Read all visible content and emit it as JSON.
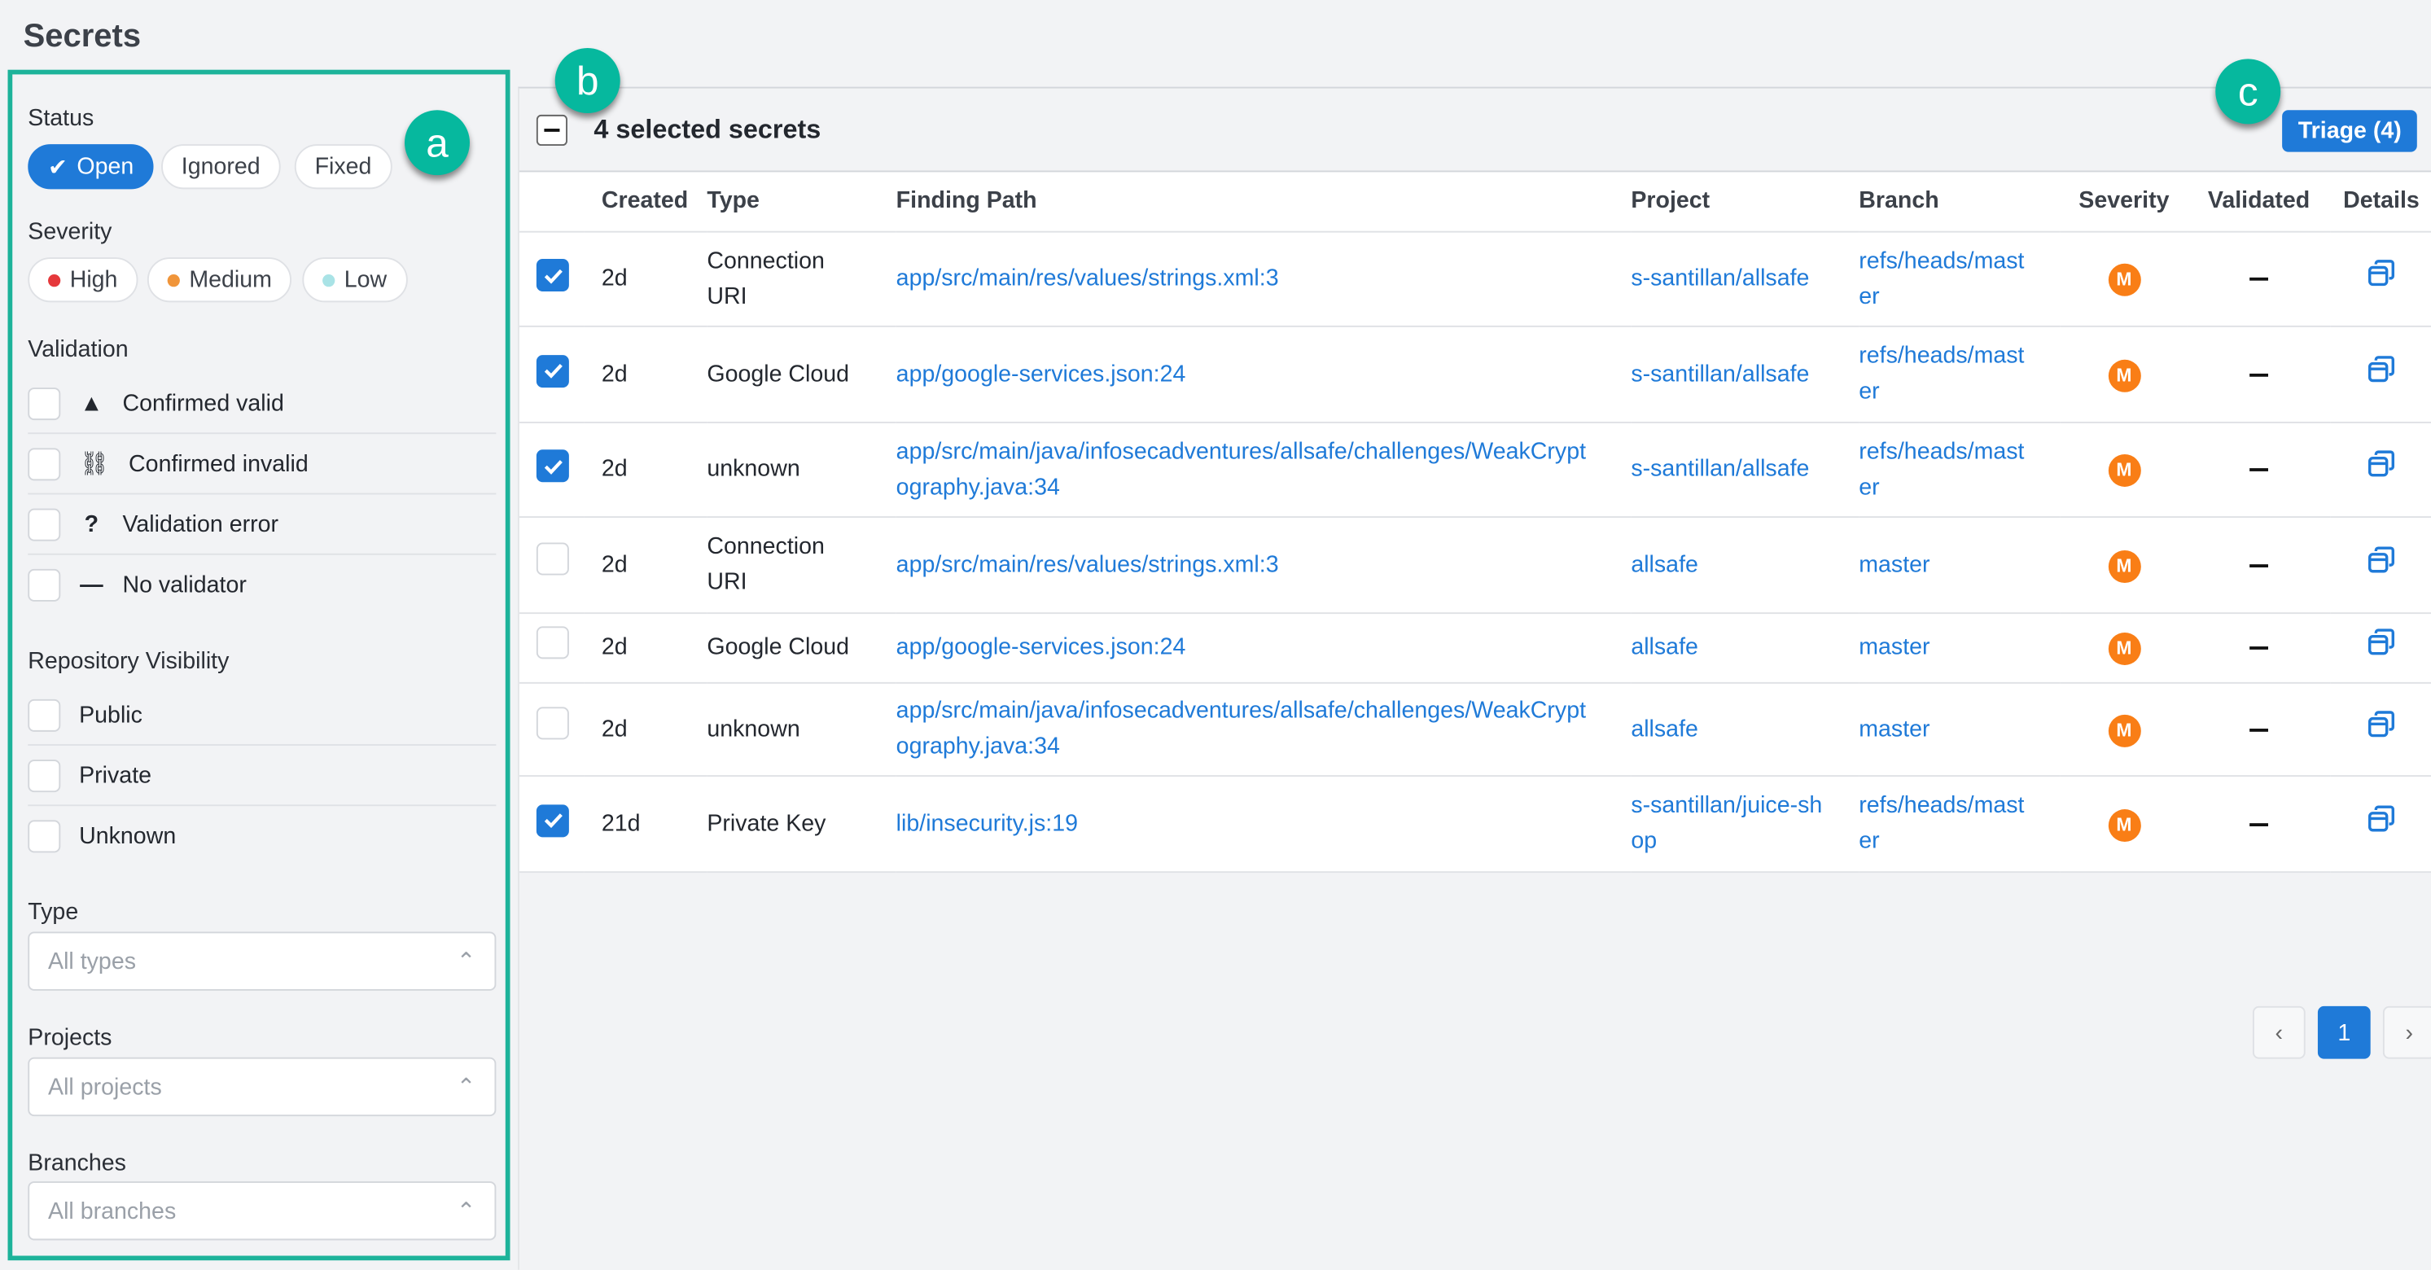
{
  "page": {
    "title": "Secrets"
  },
  "annotations": {
    "a": "a",
    "b": "b",
    "c": "c"
  },
  "filters": {
    "status": {
      "label": "Status",
      "options": [
        {
          "label": "Open",
          "active": true
        },
        {
          "label": "Ignored",
          "active": false
        },
        {
          "label": "Fixed",
          "active": false
        }
      ]
    },
    "severity": {
      "label": "Severity",
      "options": [
        {
          "label": "High",
          "color": "#e5383b"
        },
        {
          "label": "Medium",
          "color": "#f0953a"
        },
        {
          "label": "Low",
          "color": "#a9e3e6"
        }
      ]
    },
    "validation": {
      "label": "Validation",
      "options": [
        {
          "label": "Confirmed valid",
          "icon": "warning-triangle-icon",
          "glyph": "▲"
        },
        {
          "label": "Confirmed invalid",
          "icon": "broken-link-icon",
          "glyph": "⛓"
        },
        {
          "label": "Validation error",
          "icon": "question-icon",
          "glyph": "?"
        },
        {
          "label": "No validator",
          "icon": "dash-icon",
          "glyph": "—"
        }
      ]
    },
    "visibility": {
      "label": "Repository Visibility",
      "options": [
        "Public",
        "Private",
        "Unknown"
      ]
    },
    "type": {
      "label": "Type",
      "placeholder": "All types"
    },
    "projects": {
      "label": "Projects",
      "placeholder": "All projects"
    },
    "branches": {
      "label": "Branches",
      "placeholder": "All branches"
    }
  },
  "toolbar": {
    "selected_label": "4 selected secrets",
    "triage_label": "Triage (4)"
  },
  "table": {
    "columns": [
      "Created",
      "Type",
      "Finding Path",
      "Project",
      "Branch",
      "Severity",
      "Validated",
      "Details"
    ],
    "rows": [
      {
        "checked": true,
        "created": "2d",
        "type": "Connection URI",
        "path": "app/src/main/res/values/strings.xml:3",
        "project": "s-santillan/allsafe",
        "branch": "refs/heads/master",
        "severity": "M",
        "validated": "—"
      },
      {
        "checked": true,
        "created": "2d",
        "type": "Google Cloud",
        "path": "app/google-services.json:24",
        "project": "s-santillan/allsafe",
        "branch": "refs/heads/master",
        "severity": "M",
        "validated": "—"
      },
      {
        "checked": true,
        "created": "2d",
        "type": "unknown",
        "path": "app/src/main/java/infosecadventures/allsafe/challenges/WeakCryptography.java:34",
        "project": "s-santillan/allsafe",
        "branch": "refs/heads/master",
        "severity": "M",
        "validated": "—"
      },
      {
        "checked": false,
        "created": "2d",
        "type": "Connection URI",
        "path": "app/src/main/res/values/strings.xml:3",
        "project": "allsafe",
        "branch": "master",
        "severity": "M",
        "validated": "—"
      },
      {
        "checked": false,
        "created": "2d",
        "type": "Google Cloud",
        "path": "app/google-services.json:24",
        "project": "allsafe",
        "branch": "master",
        "severity": "M",
        "validated": "—"
      },
      {
        "checked": false,
        "created": "2d",
        "type": "unknown",
        "path": "app/src/main/java/infosecadventures/allsafe/challenges/WeakCryptography.java:34",
        "project": "allsafe",
        "branch": "master",
        "severity": "M",
        "validated": "—"
      },
      {
        "checked": true,
        "created": "21d",
        "type": "Private Key",
        "path": "lib/insecurity.js:19",
        "project": "s-santillan/juice-shop",
        "branch": "refs/heads/master",
        "severity": "M",
        "validated": "—"
      }
    ]
  },
  "pagination": {
    "prev": "‹",
    "current": "1",
    "next": "›"
  },
  "colors": {
    "accent": "#1f7ad8",
    "annotation": "#06b89e",
    "severity_medium": "#f97e16"
  }
}
